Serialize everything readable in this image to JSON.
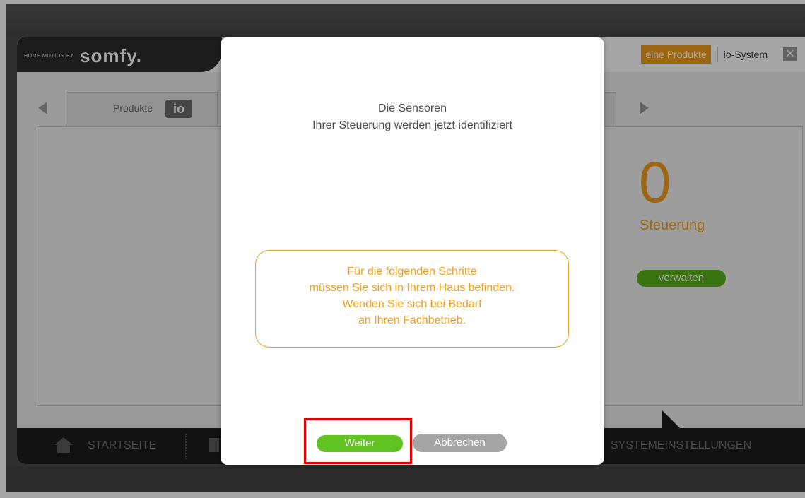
{
  "header": {
    "logo_small": "HOME MOTION BY",
    "logo_brand": "somfy.",
    "nav_active": "eine Produkte",
    "nav_link": "io-System",
    "close_label": "✕"
  },
  "tabs": {
    "active_label": "Produkte",
    "badge": "io"
  },
  "summary": {
    "count": "0",
    "count_label": "Steuerung",
    "manage_button": "verwalten"
  },
  "bottom_bar": {
    "home_label": "STARTSEITE",
    "settings_label": "SYSTEMEINSTELLUNGEN"
  },
  "modal": {
    "title_line1": "Die Sensoren",
    "title_line2": "Ihrer Steuerung werden jetzt identifiziert",
    "note_lines": [
      "Für die folgenden Schritte",
      "müssen Sie sich in Ihrem Haus befinden.",
      "Wenden Sie sich bei Bedarf",
      "an Ihren Fachbetrieb."
    ],
    "next_button": "Weiter",
    "cancel_button": "Abbrechen"
  },
  "colors": {
    "accent_orange": "#f29d1a",
    "action_green": "#5fc21f",
    "highlight_red": "#e00000"
  }
}
